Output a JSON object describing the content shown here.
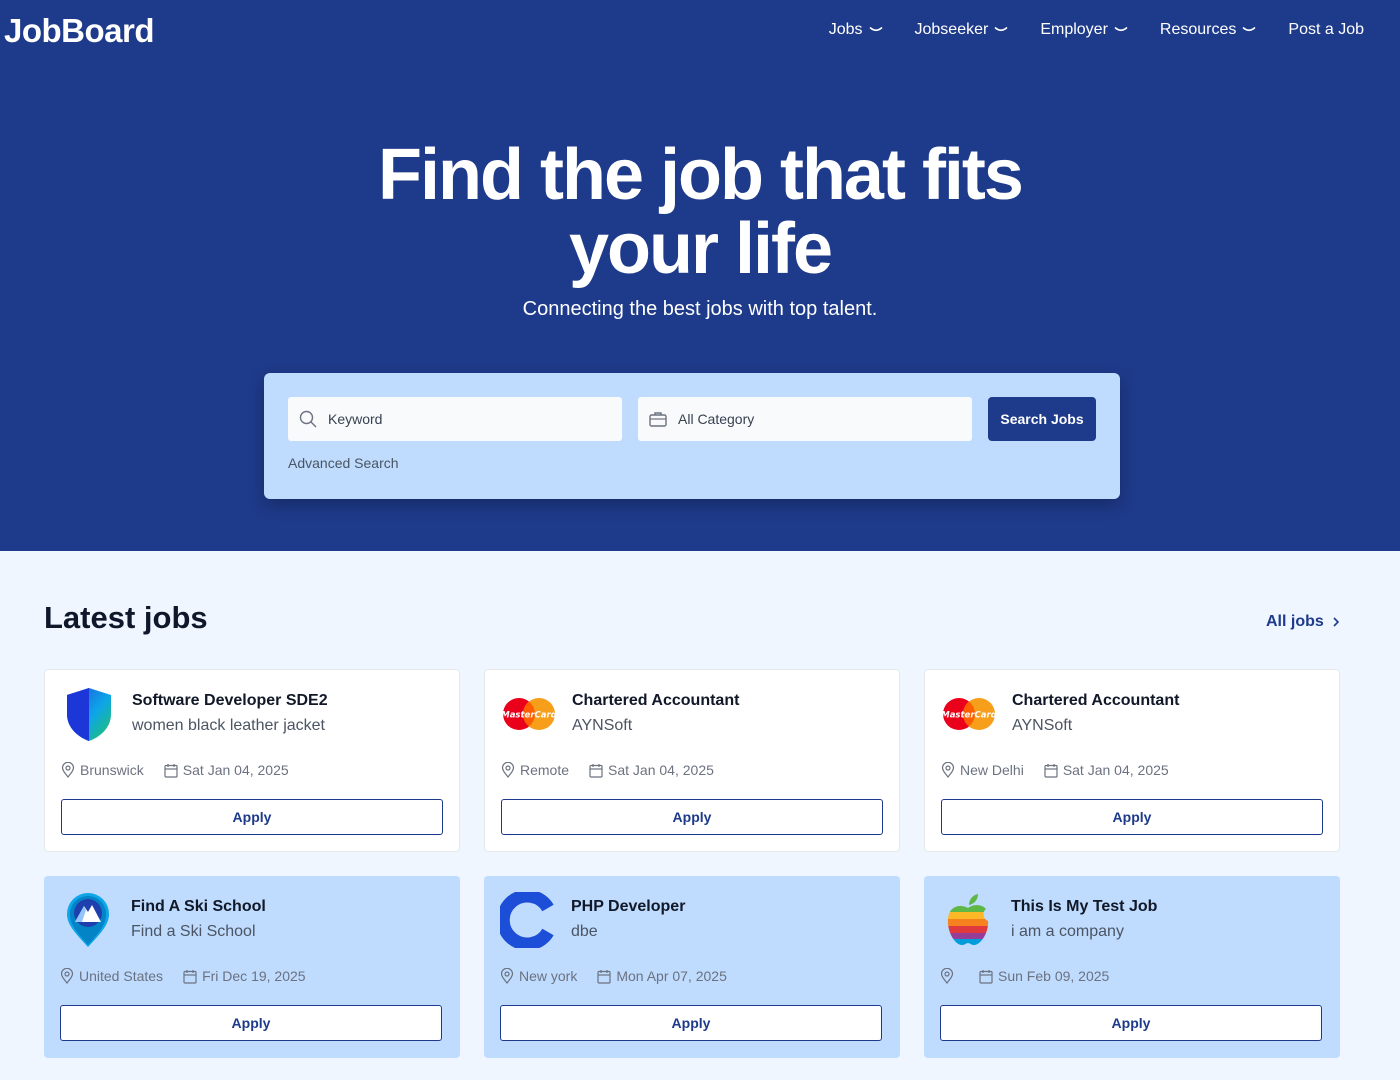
{
  "header": {
    "logo": "JobBoard",
    "nav": [
      {
        "label": "Jobs",
        "dropdown": true
      },
      {
        "label": "Jobseeker",
        "dropdown": true
      },
      {
        "label": "Employer",
        "dropdown": true
      },
      {
        "label": "Resources",
        "dropdown": true
      },
      {
        "label": "Post a Job",
        "dropdown": false
      }
    ]
  },
  "hero": {
    "headline_line1": "Find the job that fits",
    "headline_line2": "your life",
    "subheadline": "Connecting the best jobs with top talent."
  },
  "search": {
    "keyword_placeholder": "Keyword",
    "category_value": "All Category",
    "button_label": "Search Jobs",
    "advanced_label": "Advanced Search"
  },
  "latest": {
    "title": "Latest jobs",
    "all_jobs_label": "All jobs"
  },
  "jobs": [
    {
      "title": "Software Developer SDE2",
      "company": "women black leather jacket",
      "location": "Brunswick",
      "date": "Sat Jan 04, 2025",
      "apply": "Apply",
      "logo": "shield-logo"
    },
    {
      "title": "Chartered Accountant",
      "company": "AYNSoft",
      "location": "Remote",
      "date": "Sat Jan 04, 2025",
      "apply": "Apply",
      "logo": "mastercard-logo"
    },
    {
      "title": "Chartered Accountant",
      "company": "AYNSoft",
      "location": "New Delhi",
      "date": "Sat Jan 04, 2025",
      "apply": "Apply",
      "logo": "mastercard-logo"
    },
    {
      "title": "Find A Ski School",
      "company": "Find a Ski School",
      "location": "United States",
      "date": "Fri Dec 19, 2025",
      "apply": "Apply",
      "logo": "mountain-pin-logo"
    },
    {
      "title": "PHP Developer",
      "company": "dbe",
      "location": "New york",
      "date": "Mon Apr 07, 2025",
      "apply": "Apply",
      "logo": "c-letter-logo"
    },
    {
      "title": "This Is My Test Job",
      "company": "i am a company",
      "location": "",
      "date": "Sun Feb 09, 2025",
      "apply": "Apply",
      "logo": "apple-rainbow-logo"
    }
  ],
  "colors": {
    "primary": "#1e3a8a",
    "search_panel": "#bfdbfe",
    "page_bg": "#eff6ff",
    "featured_card": "#bfdbfe"
  }
}
